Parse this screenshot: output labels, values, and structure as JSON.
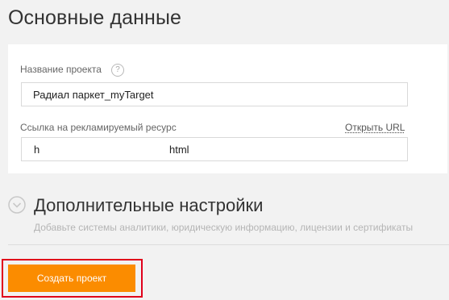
{
  "header": {
    "title": "Основные данные"
  },
  "basic": {
    "project_name_label": "Название проекта",
    "help_glyph": "?",
    "project_name_value": "Радиал паркет_myTarget",
    "url_label": "Ссылка на рекламируемый ресурс",
    "open_url_link": "Открыть URL",
    "url_value_start": "h",
    "url_value_end": "html"
  },
  "advanced": {
    "title": "Дополнительные настройки",
    "subtitle": "Добавьте системы аналитики, юридическую информацию, лицензии и сертификаты"
  },
  "actions": {
    "create_label": "Создать проект"
  },
  "colors": {
    "accent": "#fb8c00",
    "highlight": "#e0001b"
  }
}
